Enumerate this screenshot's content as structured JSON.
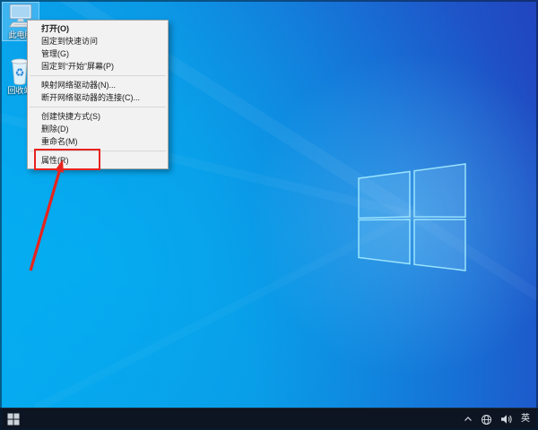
{
  "desktop": {
    "icons": [
      {
        "label": "此电脑",
        "selected": true
      },
      {
        "label": "回收站",
        "selected": false
      }
    ]
  },
  "context_menu": {
    "items": [
      {
        "label": "打开(O)",
        "default": true
      },
      {
        "label": "固定到快速访问"
      },
      {
        "label": "管理(G)"
      },
      {
        "label": "固定到“开始”屏幕(P)"
      },
      {
        "type": "separator"
      },
      {
        "label": "映射网络驱动器(N)..."
      },
      {
        "label": "断开网络驱动器的连接(C)..."
      },
      {
        "type": "separator"
      },
      {
        "label": "创建快捷方式(S)"
      },
      {
        "label": "删除(D)"
      },
      {
        "label": "重命名(M)"
      },
      {
        "type": "separator"
      },
      {
        "label": "属性(R)",
        "annotated": true
      }
    ]
  },
  "annotation": {
    "target": "属性(R)",
    "color": "#e8231d",
    "shapes": [
      "red-box",
      "red-arrow"
    ]
  },
  "taskbar": {
    "start_icon": "windows-logo",
    "tray": {
      "chevron_icon": "hidden-icons-chevron",
      "network_icon": "globe-network",
      "volume_icon": "speaker",
      "ime_label": "英"
    }
  },
  "colors": {
    "wallpaper_bright": "#08a4ec",
    "wallpaper_dark": "#2145bf",
    "menu_bg": "#f2f2f2",
    "taskbar_bg": "#0d1522",
    "annotation_red": "#e8231d"
  }
}
